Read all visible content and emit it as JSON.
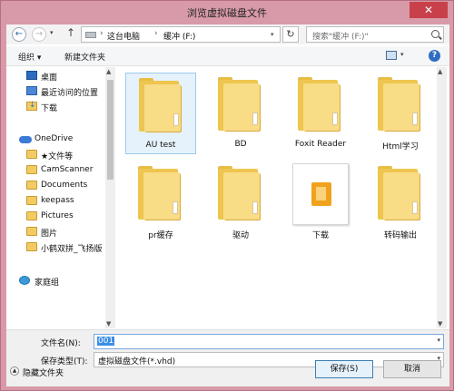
{
  "window": {
    "title": "浏览虚拟磁盘文件",
    "close_label": "✕"
  },
  "nav": {
    "back_icon": "←",
    "forward_icon": "→",
    "dropdown_icon": "▾",
    "up_icon": "↑",
    "breadcrumb": [
      "这台电脑",
      "缓冲 (F:)"
    ],
    "breadcrumb_sep": "›",
    "refresh_icon": "↻",
    "search_placeholder": "搜索\"缓冲 (F:)\""
  },
  "toolbar": {
    "organize_label": "组织 ▾",
    "new_folder_label": "新建文件夹",
    "view_dropdown": "▾",
    "help_label": "?"
  },
  "sidebar": {
    "items": [
      {
        "label": "桌面",
        "icon": "desktop-icon"
      },
      {
        "label": "最近访问的位置",
        "icon": "recent-places-icon"
      },
      {
        "label": "下载",
        "icon": "download-folder-icon"
      },
      {
        "label": "OneDrive",
        "icon": "onedrive-cloud-icon"
      },
      {
        "label": "★文件等",
        "icon": "folder-icon"
      },
      {
        "label": "CamScanner",
        "icon": "folder-icon"
      },
      {
        "label": "Documents",
        "icon": "folder-icon"
      },
      {
        "label": "keepass",
        "icon": "folder-icon"
      },
      {
        "label": "Pictures",
        "icon": "folder-icon"
      },
      {
        "label": "图片",
        "icon": "folder-icon"
      },
      {
        "label": "小鹤双拼_飞扬版",
        "icon": "folder-icon"
      },
      {
        "label": "家庭组",
        "icon": "homegroup-icon"
      }
    ]
  },
  "files": [
    {
      "name": "AU test",
      "type": "folder",
      "selected": true
    },
    {
      "name": "BD",
      "type": "folder"
    },
    {
      "name": "Foxit Reader",
      "type": "folder"
    },
    {
      "name": "Html学习",
      "type": "folder"
    },
    {
      "name": "pr缓存",
      "type": "folder"
    },
    {
      "name": "驱动",
      "type": "folder"
    },
    {
      "name": "下载",
      "type": "download-folder"
    },
    {
      "name": "转码输出",
      "type": "folder"
    }
  ],
  "form": {
    "filename_label": "文件名(N):",
    "filename_value": "001",
    "filetype_label": "保存类型(T):",
    "filetype_value": "虚拟磁盘文件(*.vhd)",
    "dropdown_icon": "▾"
  },
  "footer": {
    "hide_folders_label": "隐藏文件夹",
    "hide_icon": "▲",
    "save_label": "保存(S)",
    "cancel_label": "取消"
  },
  "scroll": {
    "up_icon": "▲",
    "down_icon": "▼"
  }
}
